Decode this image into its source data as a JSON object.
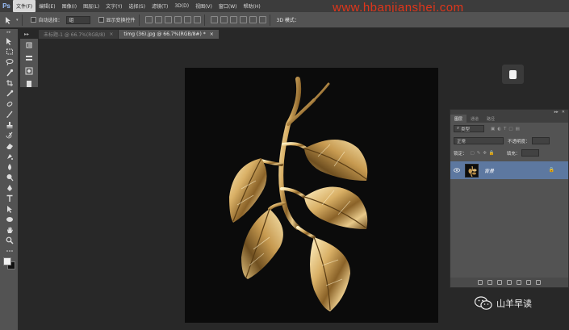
{
  "menubar": {
    "logo": "Ps",
    "items": [
      "文件(F)",
      "编辑(E)",
      "图像(I)",
      "图层(L)",
      "文字(Y)",
      "选择(S)",
      "滤镜(T)",
      "3D(D)",
      "视图(V)",
      "窗口(W)",
      "帮助(H)"
    ],
    "watermark": "www.hbanjianshei.com"
  },
  "options": {
    "auto_select_label": "自动选择：",
    "auto_select_value": "组",
    "show_transform_label": "显示变换控件",
    "mode_3d_label": "3D 模式："
  },
  "tabs": [
    {
      "label": "未标题-1 @ 66.7%(RGB/8)",
      "close": "×"
    },
    {
      "label": "timg (36).jpg @ 66.7%(RGB/8#) *",
      "close": "×"
    }
  ],
  "layers_panel": {
    "tabs": [
      "图层",
      "通道",
      "路径"
    ],
    "filter_label": "类型",
    "blend_mode": "正常",
    "opacity_label": "不透明度：",
    "lock_label": "锁定：",
    "fill_label": "填充：",
    "layer_name": "背景"
  },
  "wechat": {
    "text": "山羊早读"
  },
  "icons": {
    "toolbar": [
      "move-icon",
      "marquee-icon",
      "lasso-icon",
      "quick-select-icon",
      "crop-icon",
      "eyedropper-icon",
      "healing-icon",
      "brush-icon",
      "stamp-icon",
      "history-brush-icon",
      "eraser-icon",
      "gradient-icon",
      "blur-icon",
      "dodge-icon",
      "pen-icon",
      "type-icon",
      "path-select-icon",
      "shape-icon",
      "hand-icon",
      "zoom-icon"
    ]
  },
  "colors": {
    "accent": "#5d78a0",
    "watermark": "#e0361b",
    "foreground": "#f2f2f2",
    "background": "#111111"
  }
}
